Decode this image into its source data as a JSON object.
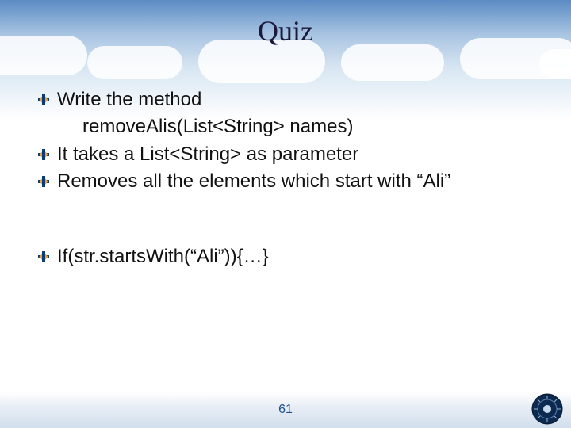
{
  "title": "Quiz",
  "bullets": [
    {
      "text": "Write the method",
      "indent": false
    },
    {
      "text": "removeAlis(List<String> names)",
      "indent": true
    },
    {
      "text": "It takes a List<String> as parameter",
      "indent": false
    },
    {
      "text": "Removes all the elements which start with “Ali”",
      "indent": false
    }
  ],
  "hint": "If(str.startsWith(“Ali”)){…}",
  "page_number": "61",
  "icons": {
    "bullet": "plus-diamond-icon",
    "seal": "university-seal-icon"
  }
}
